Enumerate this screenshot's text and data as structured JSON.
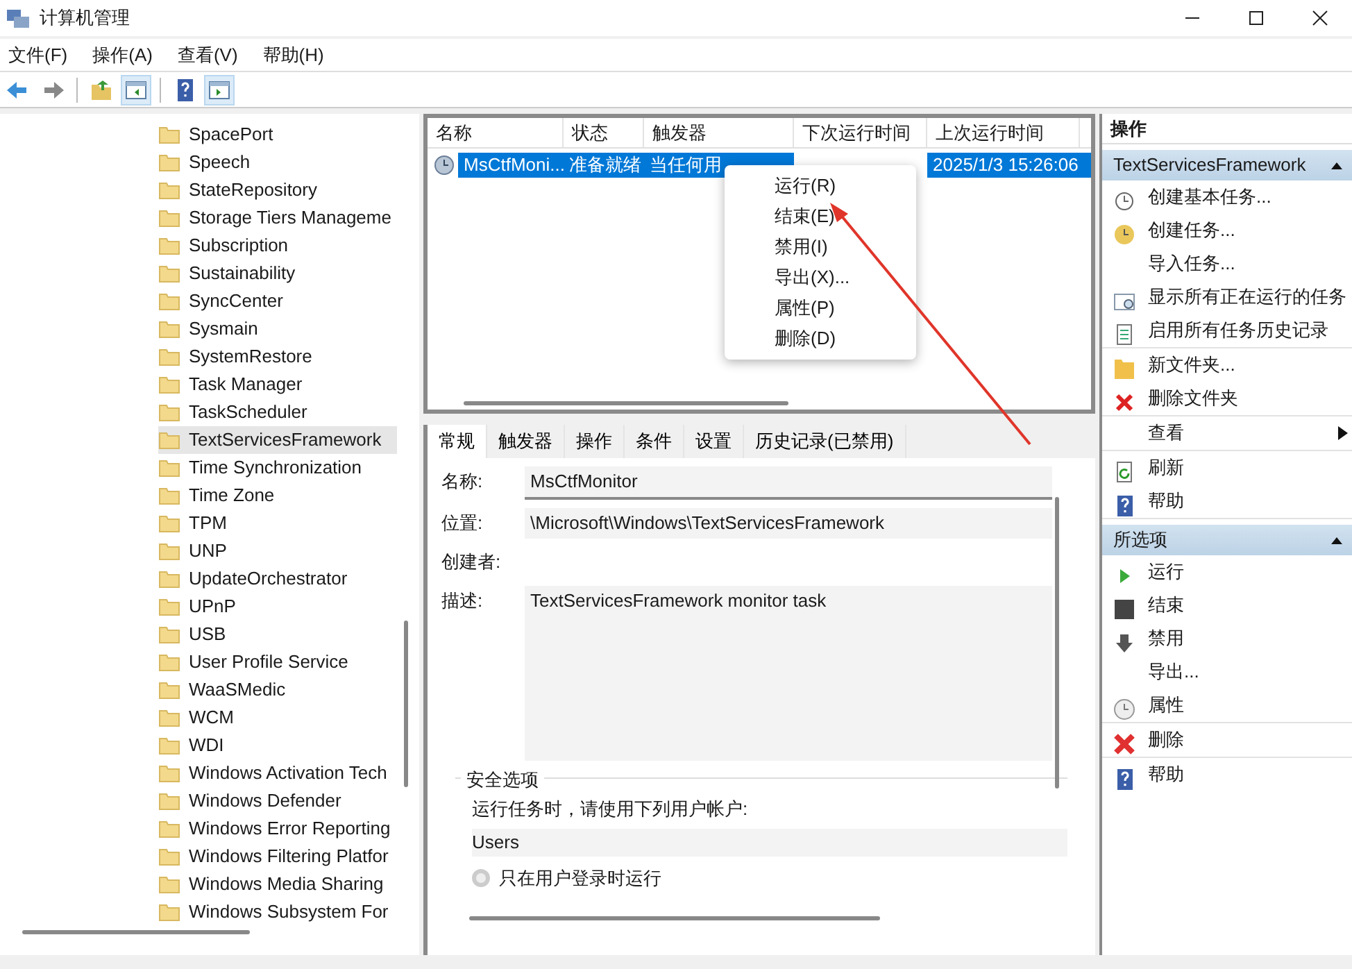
{
  "window": {
    "title": "计算机管理"
  },
  "menu": [
    "文件(F)",
    "操作(A)",
    "查看(V)",
    "帮助(H)"
  ],
  "toolbar": [
    {
      "pressed": false
    },
    {
      "pressed": false
    },
    {
      "pressed": false
    },
    {
      "pressed": true
    },
    {
      "pressed": false
    },
    {
      "pressed": true
    }
  ],
  "tree": [
    {
      "label": "SpacePort",
      "selected": false
    },
    {
      "label": "Speech",
      "selected": false
    },
    {
      "label": "StateRepository",
      "selected": false
    },
    {
      "label": "Storage Tiers Manageme",
      "selected": false
    },
    {
      "label": "Subscription",
      "selected": false
    },
    {
      "label": "Sustainability",
      "selected": false
    },
    {
      "label": "SyncCenter",
      "selected": false
    },
    {
      "label": "Sysmain",
      "selected": false
    },
    {
      "label": "SystemRestore",
      "selected": false
    },
    {
      "label": "Task Manager",
      "selected": false
    },
    {
      "label": "TaskScheduler",
      "selected": false
    },
    {
      "label": "TextServicesFramework",
      "selected": true
    },
    {
      "label": "Time Synchronization",
      "selected": false
    },
    {
      "label": "Time Zone",
      "selected": false
    },
    {
      "label": "TPM",
      "selected": false
    },
    {
      "label": "UNP",
      "selected": false
    },
    {
      "label": "UpdateOrchestrator",
      "selected": false
    },
    {
      "label": "UPnP",
      "selected": false
    },
    {
      "label": "USB",
      "selected": false
    },
    {
      "label": "User Profile Service",
      "selected": false
    },
    {
      "label": "WaaSMedic",
      "selected": false
    },
    {
      "label": "WCM",
      "selected": false
    },
    {
      "label": "WDI",
      "selected": false
    },
    {
      "label": "Windows Activation Tech",
      "selected": false
    },
    {
      "label": "Windows Defender",
      "selected": false
    },
    {
      "label": "Windows Error Reporting",
      "selected": false
    },
    {
      "label": "Windows Filtering Platfor",
      "selected": false
    },
    {
      "label": "Windows Media Sharing",
      "selected": false
    },
    {
      "label": "Windows Subsystem For",
      "selected": false
    }
  ],
  "task_table": {
    "columns": [
      "名称",
      "状态",
      "触发器",
      "下次运行时间",
      "上次运行时间"
    ],
    "rows": [
      {
        "selected": true,
        "cells": [
          "MsCtfMoni...",
          "准备就绪",
          "当任何用",
          "",
          "2025/1/3 15:26:06"
        ]
      }
    ]
  },
  "context_menu": [
    "运行(R)",
    "结束(E)",
    "禁用(I)",
    "导出(X)...",
    "属性(P)",
    "删除(D)"
  ],
  "detail_tabs": [
    {
      "label": "常规",
      "selected": true
    },
    {
      "label": "触发器",
      "selected": false
    },
    {
      "label": "操作",
      "selected": false
    },
    {
      "label": "条件",
      "selected": false
    },
    {
      "label": "设置",
      "selected": false
    },
    {
      "label": "历史记录(已禁用)",
      "selected": false
    }
  ],
  "details": {
    "name_label": "名称:",
    "name": "MsCtfMonitor",
    "location_label": "位置:",
    "location": "\\Microsoft\\Windows\\TextServicesFramework",
    "author_label": "创建者:",
    "description_label": "描述:",
    "description": "TextServicesFramework monitor task",
    "security": {
      "title": "安全选项",
      "prompt": "运行任务时，请使用下列用户帐户:",
      "account": "Users",
      "options": [
        {
          "label": "只在用户登录时运行",
          "selected": false
        }
      ]
    }
  },
  "actions": {
    "title": "操作",
    "sections": [
      {
        "title": "TextServicesFramework",
        "expanded": true,
        "groups": [
          [
            {
              "label": "创建基本任务..."
            },
            {
              "label": "创建任务..."
            },
            {
              "label": "导入任务..."
            },
            {
              "label": "显示所有正在运行的任务"
            },
            {
              "label": "启用所有任务历史记录"
            }
          ],
          [
            {
              "label": "新文件夹..."
            },
            {
              "label": "删除文件夹"
            }
          ],
          [
            {
              "label": "查看",
              "submenu": true
            }
          ],
          [
            {
              "label": "刷新"
            },
            {
              "label": "帮助"
            }
          ]
        ]
      },
      {
        "title": "所选项",
        "expanded": true,
        "groups": [
          [
            {
              "label": "运行"
            },
            {
              "label": "结束"
            },
            {
              "label": "禁用"
            },
            {
              "label": "导出..."
            },
            {
              "label": "属性"
            }
          ],
          [
            {
              "label": "删除"
            }
          ],
          [
            {
              "label": "帮助"
            }
          ]
        ]
      }
    ]
  }
}
